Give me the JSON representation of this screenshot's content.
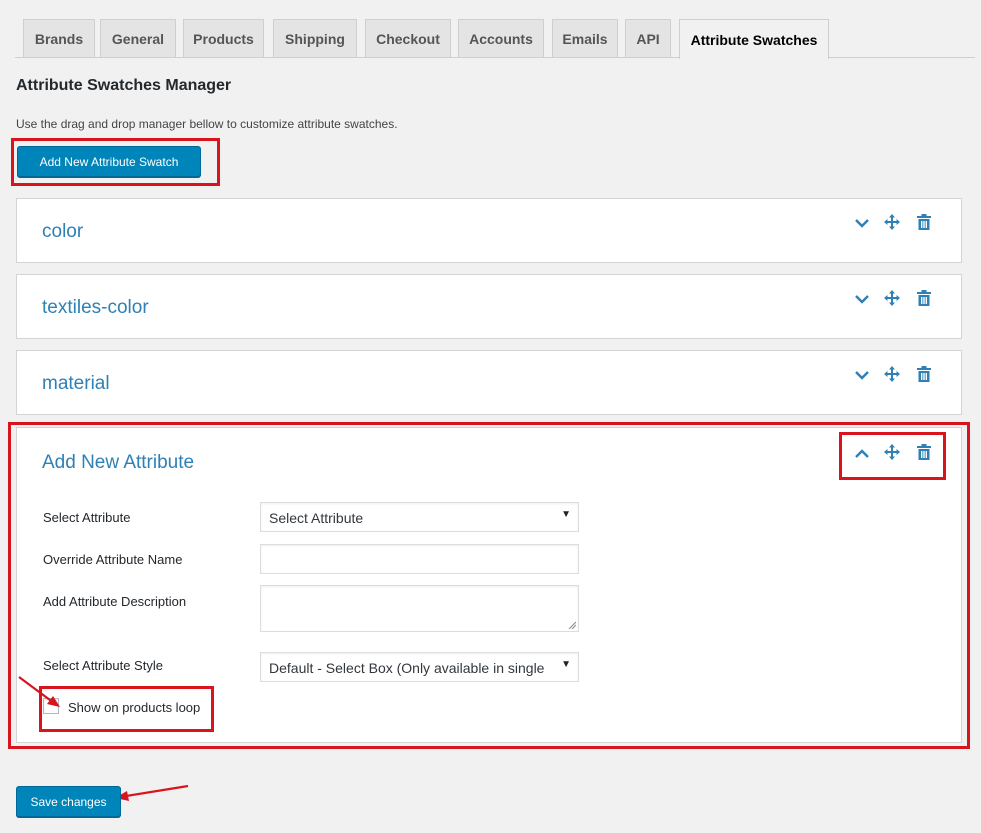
{
  "tabs": [
    "Brands",
    "General",
    "Products",
    "Shipping",
    "Checkout",
    "Accounts",
    "Emails",
    "API",
    "Attribute Swatches"
  ],
  "active_tab": "Attribute Swatches",
  "page": {
    "title": "Attribute Swatches Manager",
    "description": "Use the drag and drop manager bellow to customize attribute swatches.",
    "add_button": "Add New Attribute Swatch",
    "save_button": "Save changes"
  },
  "swatches": [
    {
      "name": "color"
    },
    {
      "name": "textiles-color"
    },
    {
      "name": "material"
    }
  ],
  "new_attribute": {
    "title": "Add New Attribute",
    "select_attribute_label": "Select Attribute",
    "select_attribute_value": "Select Attribute",
    "override_name_label": "Override Attribute Name",
    "override_name_value": "",
    "description_label": "Add Attribute Description",
    "description_value": "",
    "style_label": "Select Attribute Style",
    "style_value": "Default - Select Box (Only available in single",
    "loop_label": "Show on products loop",
    "loop_checked": false
  },
  "icons": [
    "chevron-down-icon",
    "chevron-up-icon",
    "move-icon",
    "trash-icon"
  ],
  "colors": {
    "accent": "#0085ba",
    "title_blue": "#2e80b5",
    "highlight_red": "#d9141e",
    "background": "#f1f1f1"
  }
}
